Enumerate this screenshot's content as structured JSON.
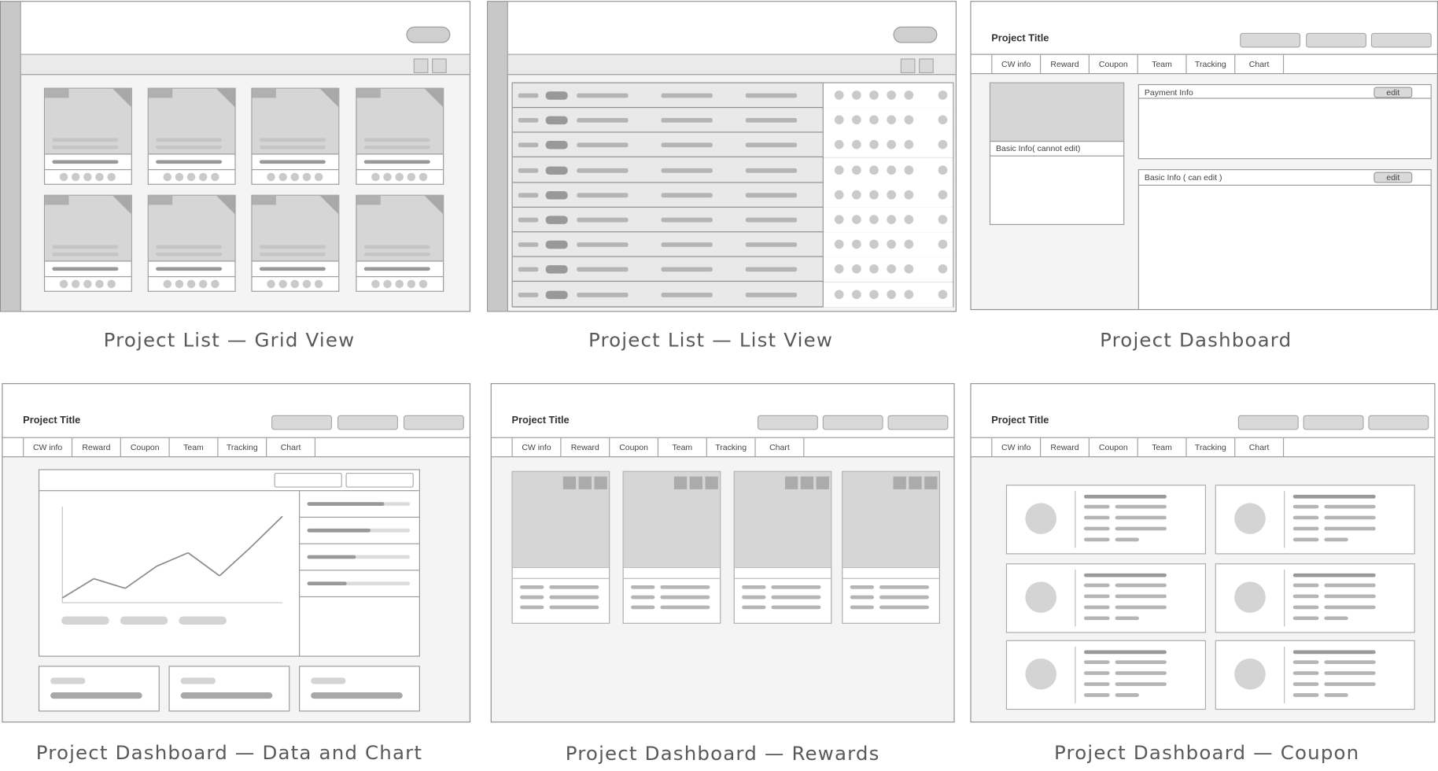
{
  "captions": {
    "grid": "Project List — Grid View",
    "list": "Project List — List View",
    "dashboard": "Project Dashboard",
    "data_chart": "Project Dashboard — Data and Chart",
    "rewards": "Project Dashboard — Rewards",
    "coupon": "Project Dashboard — Coupon"
  },
  "project_title": "Project Title",
  "tabs": [
    "CW info",
    "Reward",
    "Coupon",
    "Team",
    "Tracking",
    "Chart"
  ],
  "dashboard": {
    "basic_info_readonly": "Basic Info( cannot edit)",
    "payment_info": "Payment Info",
    "basic_info_editable": "Basic Info ( can edit )",
    "edit_label": "edit"
  },
  "chart_data": {
    "type": "line",
    "x": [
      1,
      2,
      3,
      4,
      5,
      6,
      7,
      8
    ],
    "values": [
      0.05,
      0.25,
      0.15,
      0.38,
      0.52,
      0.28,
      0.58,
      0.9
    ],
    "title": "",
    "xlabel": "",
    "ylabel": "",
    "ylim": [
      0,
      1
    ],
    "grid": false,
    "legend": "none"
  },
  "chart_side_bars": [
    0.75,
    0.62,
    0.47,
    0.38
  ],
  "colors": {
    "frame_border": "#8f8f8f",
    "placeholder_fill": "#d6d6d6",
    "line": "#8c8c8c",
    "caption": "#595959"
  }
}
